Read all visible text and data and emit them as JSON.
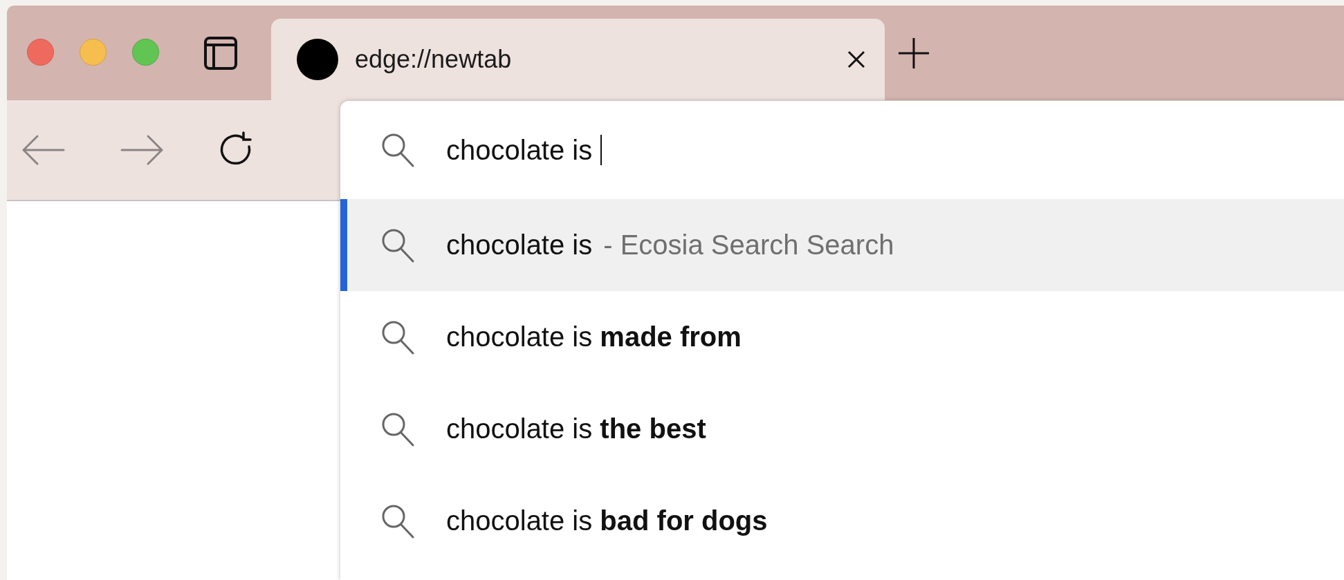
{
  "tabs": [
    {
      "title": "edge://newtab",
      "selected": true
    }
  ],
  "omnibox": {
    "value": "chocolate is"
  },
  "suggestions": [
    {
      "kind": "search",
      "text": "chocolate is",
      "hint": "- Ecosia Search Search",
      "selected": true
    },
    {
      "kind": "completion",
      "text": "chocolate is **made from**",
      "selected": false
    },
    {
      "kind": "completion",
      "text": "chocolate is **the best**",
      "selected": false
    },
    {
      "kind": "completion",
      "text": "chocolate is **bad for dogs**",
      "selected": false
    }
  ]
}
